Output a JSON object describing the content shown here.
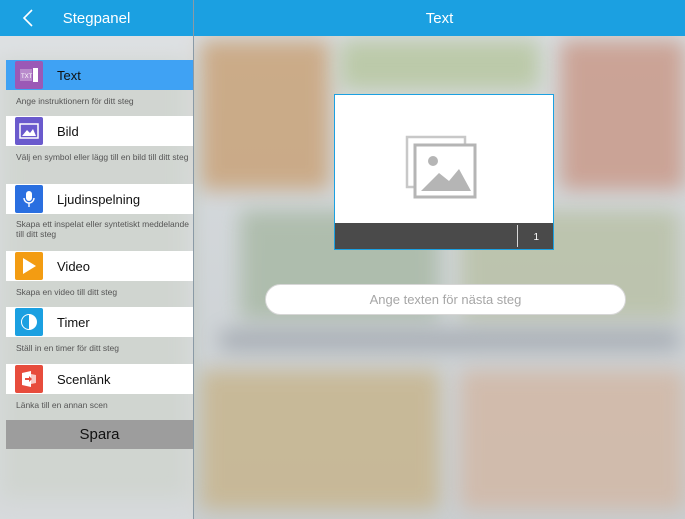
{
  "header": {
    "left_title": "Stegpanel",
    "right_title": "Text"
  },
  "steps": [
    {
      "label": "Text",
      "icon": "text-icon",
      "color": "#9b59b6",
      "description": "Ange instruktionern för ditt steg"
    },
    {
      "label": "Bild",
      "icon": "image-icon",
      "color": "#6a5acd",
      "description": "Välj en symbol eller lägg till en bild till ditt steg"
    },
    {
      "label": "Ljudinspelning",
      "icon": "microphone-icon",
      "color": "#2a6fe0",
      "description": "Skapa ett inspelat eller syntetiskt meddelande till ditt steg"
    },
    {
      "label": "Video",
      "icon": "play-icon",
      "color": "#f39c12",
      "description": "Skapa en video till ditt steg"
    },
    {
      "label": "Timer",
      "icon": "timer-icon",
      "color": "#1ba0e1",
      "description": "Ställ in en timer för ditt steg"
    },
    {
      "label": "Scenlänk",
      "icon": "scene-link-icon",
      "color": "#e74c3c",
      "description": "Länka till en annan scen"
    }
  ],
  "save_label": "Spara",
  "card": {
    "number": "1"
  },
  "next_step": {
    "placeholder": "Ange texten för nästa steg",
    "value": ""
  },
  "colors": {
    "accent": "#1ba0e1",
    "active_step": "#3fa2f4",
    "save_button": "#9d9d9d"
  }
}
